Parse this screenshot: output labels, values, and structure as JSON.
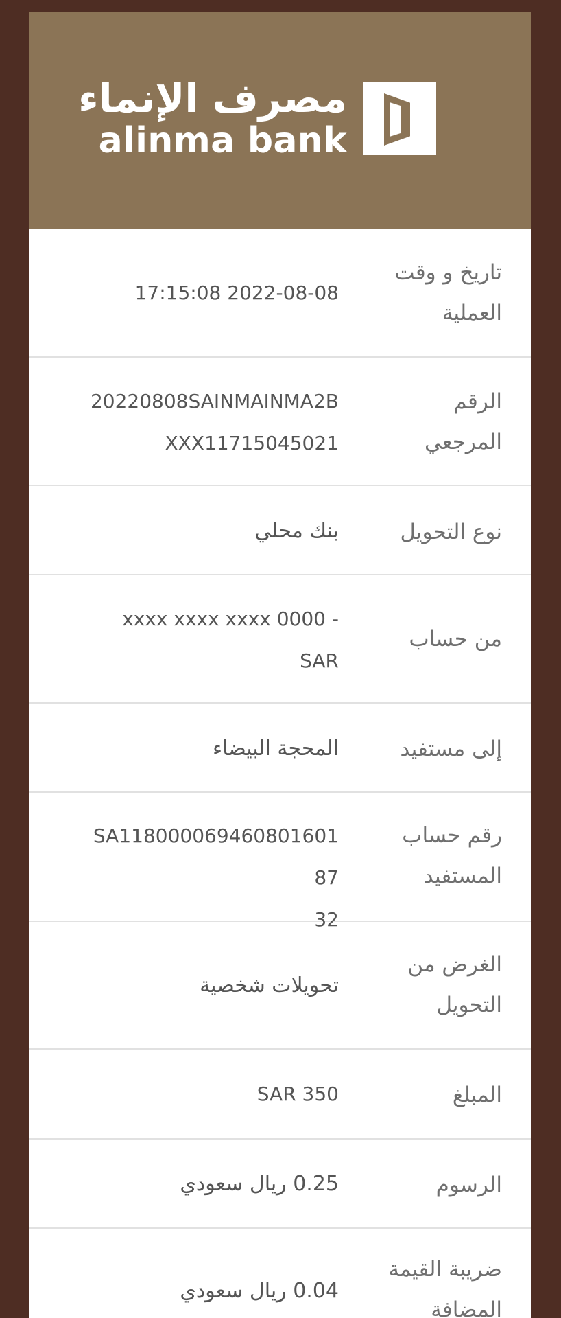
{
  "bank": {
    "name_ar": "مصرف الإنماء",
    "name_en": "alinma bank"
  },
  "details": [
    {
      "label": "تاريخ و وقت\nالعملية",
      "value": "17:15:08 2022-08-08"
    },
    {
      "label": "الرقم\nالمرجعي",
      "value": "20220808SAINMAINMA2B\nXXX11715045021"
    },
    {
      "label": "نوع التحويل",
      "value": "بنك محلي"
    },
    {
      "label": "من حساب",
      "value": "xxxx xxxx xxxx 0000 -\nSAR"
    },
    {
      "label": "إلى مستفيد",
      "value": "المحجة البيضاء"
    },
    {
      "label": "رقم حساب\nالمستفيد",
      "value": "SA118000069460801601 87\n32"
    },
    {
      "label": "الغرض من\nالتحويل",
      "value": "تحويلات شخصية"
    },
    {
      "label": "المبلغ",
      "value": "SAR 350"
    },
    {
      "label": "الرسوم",
      "value": "0.25 ريال سعودي"
    },
    {
      "label": "ضريبة القيمة\nالمضافة",
      "value": "0.04 ريال سعودي"
    }
  ]
}
